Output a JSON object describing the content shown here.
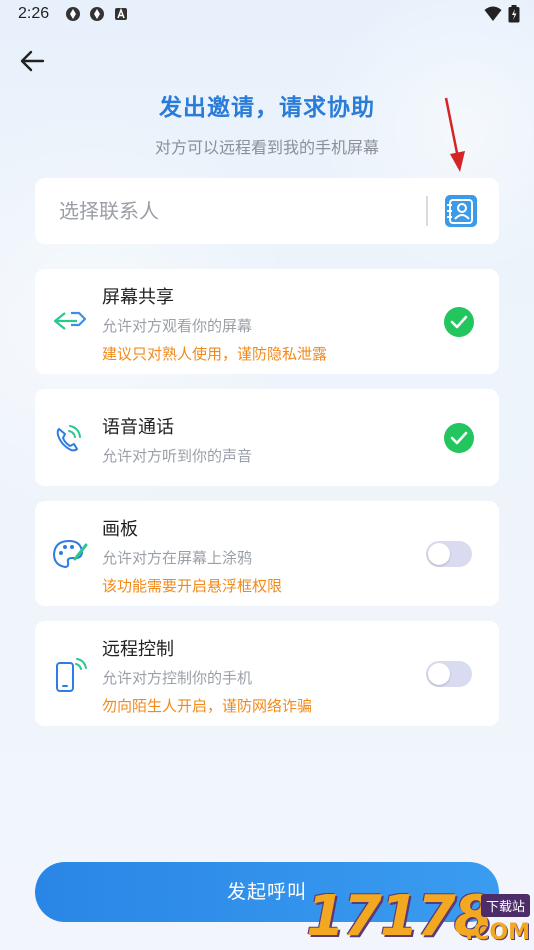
{
  "status_bar": {
    "time": "2:26"
  },
  "header": {
    "title": "发出邀请，请求协助",
    "subtitle": "对方可以远程看到我的手机屏幕"
  },
  "contact": {
    "placeholder": "选择联系人"
  },
  "cards": [
    {
      "title": "屏幕共享",
      "desc": "允许对方观看你的屏幕",
      "warning": "建议只对熟人使用，谨防隐私泄露",
      "enabled": true,
      "icon": "screen-share-icon"
    },
    {
      "title": "语音通话",
      "desc": "允许对方听到你的声音",
      "enabled": true,
      "icon": "phone-call-icon"
    },
    {
      "title": "画板",
      "desc": "允许对方在屏幕上涂鸦",
      "warning": "该功能需要开启悬浮框权限",
      "enabled": false,
      "icon": "palette-icon"
    },
    {
      "title": "远程控制",
      "desc": "允许对方控制你的手机",
      "warning": "勿向陌生人开启，谨防网络诈骗",
      "enabled": false,
      "icon": "remote-phone-icon"
    }
  ],
  "call_button": {
    "label": "发起呼叫"
  },
  "watermark": {
    "digits": "17178",
    "badge": "下载站",
    "suffix": ".COM"
  },
  "colors": {
    "accent": "#2a7cd9",
    "check": "#22c55e",
    "warning": "#f28a1a",
    "toggle_off": "#d9dcf0"
  }
}
